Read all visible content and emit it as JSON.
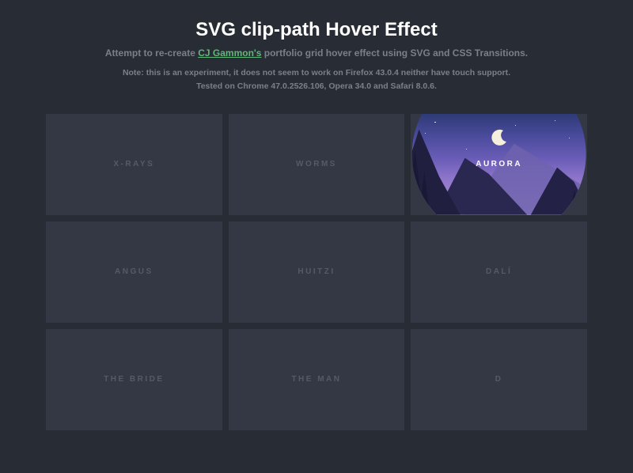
{
  "header": {
    "title": "SVG clip-path Hover Effect",
    "subtitle_pre": "Attempt to re-create ",
    "subtitle_link": "CJ Gammon's",
    "subtitle_post": " portfolio grid hover effect using SVG and CSS Transitions.",
    "note_label": "Note:",
    "note_line1": " this is an experiment, it does not seem to work on Firefox 43.0.4 neither have touch support.",
    "note_line2": "Tested on Chrome 47.0.2526.106, Opera 34.0 and Safari 8.0.6."
  },
  "grid": {
    "items": [
      {
        "label": "X-RAYS"
      },
      {
        "label": "WORMS"
      },
      {
        "label": "AURORA",
        "active": true
      },
      {
        "label": "ANGUS"
      },
      {
        "label": "HUITZI"
      },
      {
        "label": "DALÍ"
      },
      {
        "label": "THE BRIDE"
      },
      {
        "label": "THE MAN"
      },
      {
        "label": "D"
      }
    ]
  },
  "colors": {
    "bg": "#282c34",
    "card": "#343844",
    "muted": "#7b8088",
    "link": "#5fb878",
    "label_idle": "#555a66"
  }
}
